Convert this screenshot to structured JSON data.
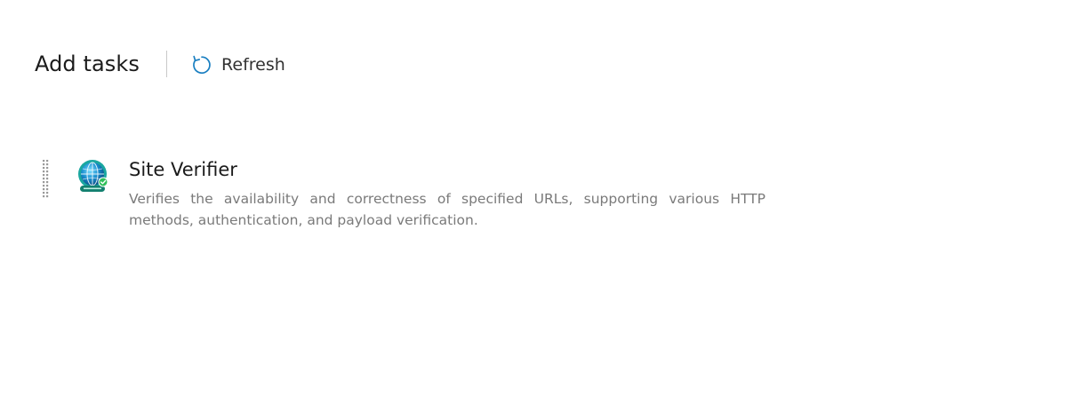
{
  "header": {
    "title": "Add tasks",
    "refresh_label": "Refresh"
  },
  "tasks": [
    {
      "name": "Site Verifier",
      "description": "Verifies the availability and correctness of specified URLs, supporting various HTTP methods, authentication, and payload verification.",
      "icon": "globe-icon"
    }
  ],
  "colors": {
    "accent": "#1a7fc1",
    "globe_teal": "#1aa7a0",
    "description_text": "#7a7a7a"
  }
}
